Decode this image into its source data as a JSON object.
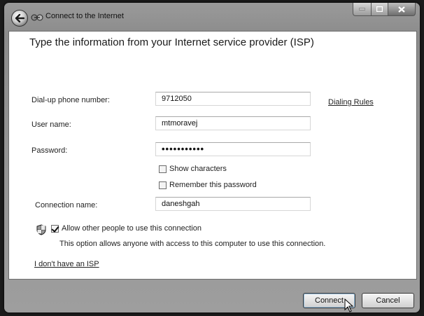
{
  "window": {
    "title": "Connect to the Internet",
    "controls": {
      "minimize": "minimize",
      "maximize": "maximize",
      "close": "close"
    }
  },
  "heading": "Type the information from your Internet service provider (ISP)",
  "form": {
    "phone_label": "Dial-up phone number:",
    "phone_value": "9712050",
    "dialing_rules_link": "Dialing Rules",
    "username_label": "User name:",
    "username_value": "mtmoravej",
    "password_label": "Password:",
    "password_value": "•••••••••••",
    "show_characters_label": "Show characters",
    "show_characters_checked": false,
    "remember_password_label": "Remember this password",
    "remember_password_checked": false,
    "connection_name_label": "Connection name:",
    "connection_name_value": "daneshgah"
  },
  "sharing": {
    "allow_others_label": "Allow other people to use this connection",
    "allow_others_checked": true,
    "description": "This option allows anyone with access to this computer to use this connection."
  },
  "no_isp_link": "I don't have an ISP",
  "buttons": {
    "connect": "Connect",
    "cancel": "Cancel"
  },
  "icons": {
    "back": "back-arrow-icon",
    "title": "network-connection-icon",
    "shield": "uac-shield-icon",
    "cursor": "mouse-pointer-icon"
  }
}
